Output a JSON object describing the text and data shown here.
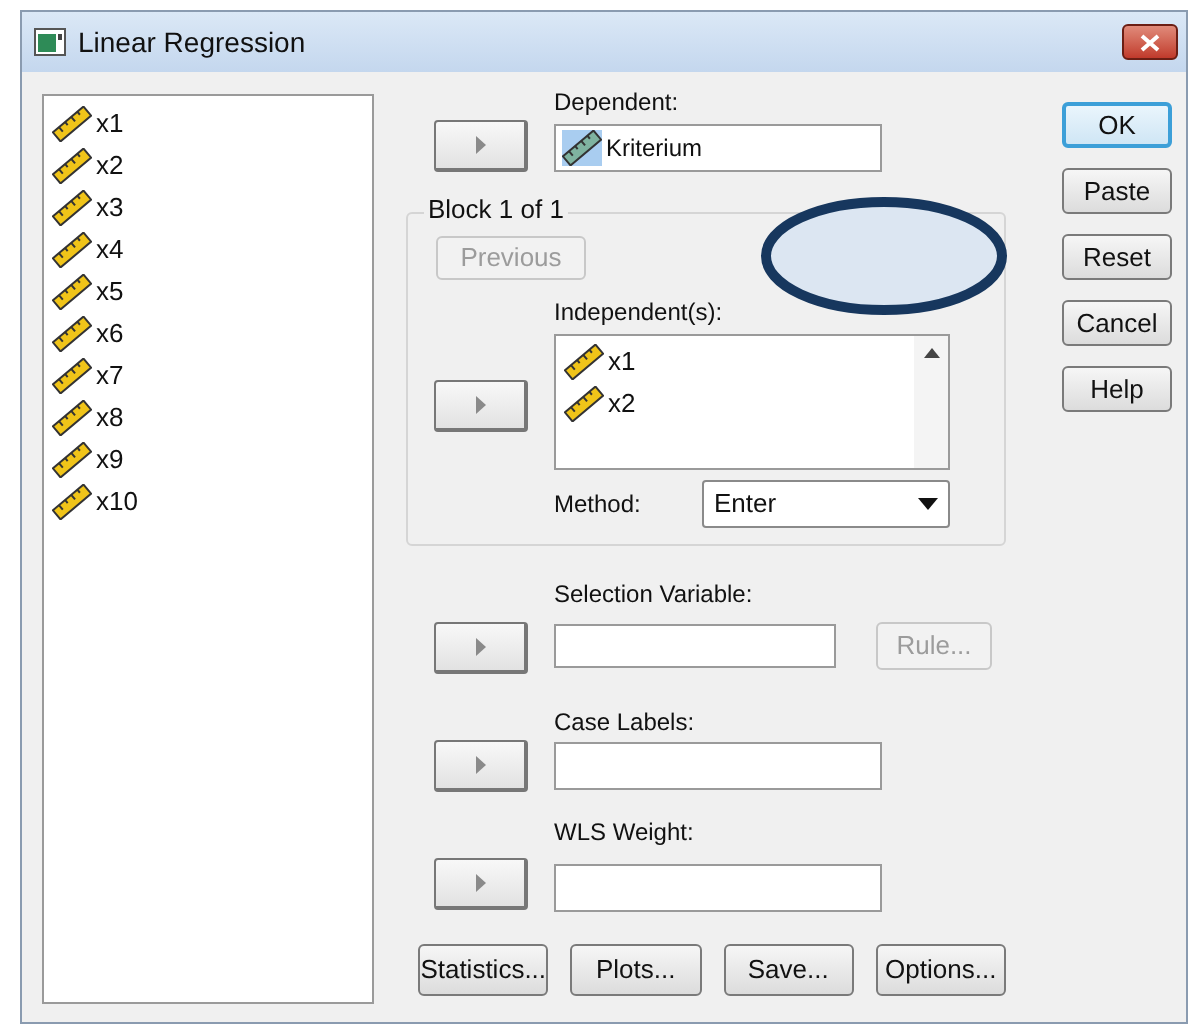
{
  "window": {
    "title": "Linear Regression"
  },
  "variables": [
    {
      "name": "x1"
    },
    {
      "name": "x2"
    },
    {
      "name": "x3"
    },
    {
      "name": "x4"
    },
    {
      "name": "x5"
    },
    {
      "name": "x6"
    },
    {
      "name": "x7"
    },
    {
      "name": "x8"
    },
    {
      "name": "x9"
    },
    {
      "name": "x10"
    }
  ],
  "dependent": {
    "label": "Dependent:",
    "value": "Kriterium",
    "selected": true
  },
  "block": {
    "label": "Block 1 of 1",
    "previous_button": {
      "label": "Previous",
      "disabled": true
    }
  },
  "independents": {
    "label": "Independent(s):",
    "items": [
      {
        "name": "x1"
      },
      {
        "name": "x2"
      }
    ]
  },
  "method": {
    "label": "Method:",
    "value": "Enter"
  },
  "selection_variable": {
    "label": "Selection Variable:",
    "rule_button": {
      "label": "Rule...",
      "disabled": true
    }
  },
  "case_labels": {
    "label": "Case Labels:"
  },
  "wls_weight": {
    "label": "WLS Weight:"
  },
  "bottom_buttons": [
    "Statistics...",
    "Plots...",
    "Save...",
    "Options..."
  ],
  "side_buttons": [
    {
      "label": "OK",
      "default": true
    },
    {
      "label": "Paste",
      "default": false
    },
    {
      "label": "Reset",
      "default": false
    },
    {
      "label": "Cancel",
      "default": false
    },
    {
      "label": "Help",
      "default": false
    }
  ]
}
